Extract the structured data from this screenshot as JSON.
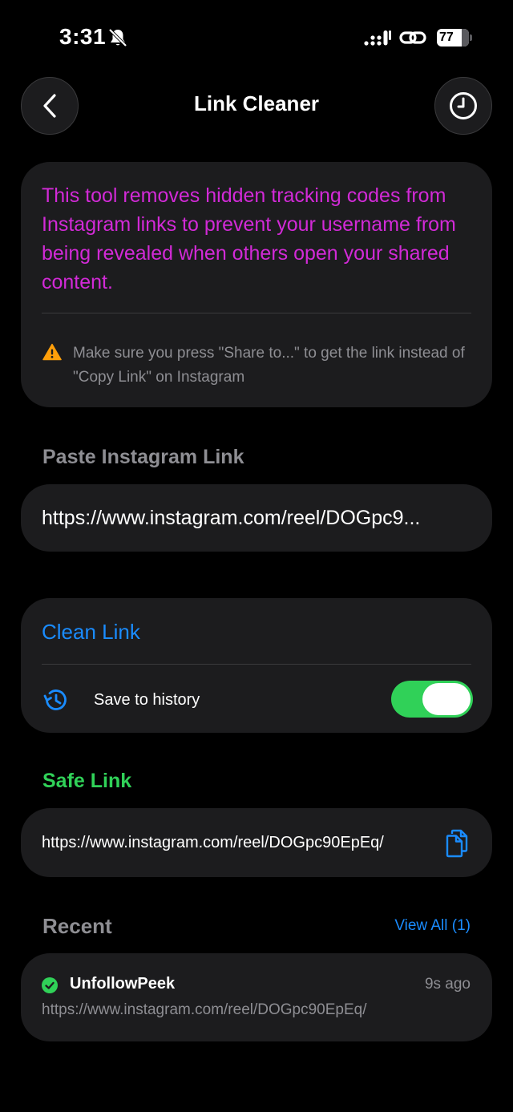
{
  "status_bar": {
    "time": "3:31",
    "battery": "77",
    "battery_level": 0.77,
    "icons": [
      "bell-slash-icon",
      "signal-icon",
      "link-icon",
      "battery-icon"
    ]
  },
  "nav": {
    "title": "Link Cleaner",
    "back_icon": "chevron-left-icon",
    "history_icon": "clock-icon"
  },
  "info": {
    "description": "This tool removes hidden tracking codes from Instagram links to prevent your username from being revealed when others open your shared content.",
    "warning": "Make sure you press \"Share to...\" to get the link instead of \"Copy Link\" on Instagram",
    "warning_icon": "warning-triangle-icon"
  },
  "input": {
    "label": "Paste Instagram Link",
    "value": "https://www.instagram.com/reel/DOGpc9..."
  },
  "clean": {
    "button_label": "Clean Link",
    "save_history_label": "Save to history",
    "save_history_enabled": true
  },
  "safe": {
    "label": "Safe Link",
    "url": "https://www.instagram.com/reel/DOGpc90EpEq/"
  },
  "recent": {
    "label": "Recent",
    "view_all": "View All (1)",
    "items": [
      {
        "title": "UnfollowPeek",
        "time": "9s ago",
        "url": "https://www.instagram.com/reel/DOGpc90EpEq/"
      }
    ]
  },
  "colors": {
    "accent_blue": "#1a8cff",
    "accent_green": "#30d158",
    "description_magenta": "#d22ad7",
    "warning_orange": "#ff9f0a"
  }
}
